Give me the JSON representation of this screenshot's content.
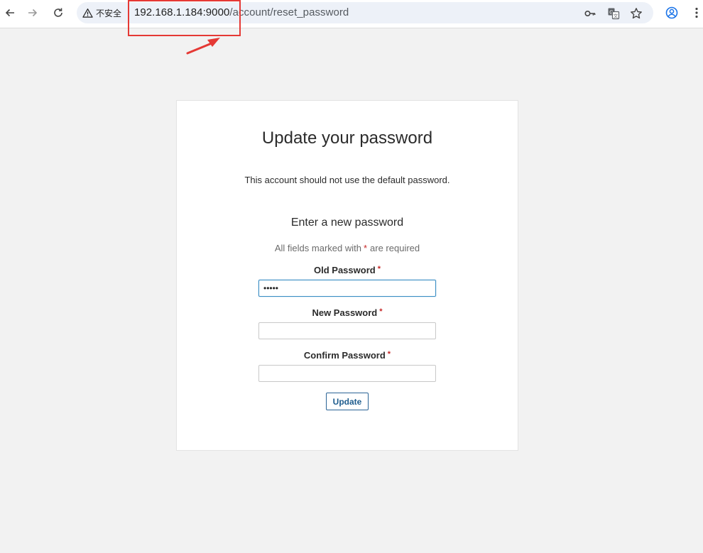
{
  "browser": {
    "security_label": "不安全",
    "url_host": "192.168.1.184:9000",
    "url_path": "/account/reset_password"
  },
  "page": {
    "title": "Update your password",
    "subtitle": "This account should not use the default password.",
    "section_title": "Enter a new password",
    "required_note_prefix": "All fields marked with",
    "required_star": "*",
    "required_note_suffix": "are required",
    "fields": [
      {
        "label": "Old Password",
        "value": "•••••",
        "placeholder": ""
      },
      {
        "label": "New Password",
        "value": "",
        "placeholder": ""
      },
      {
        "label": "Confirm Password",
        "value": "",
        "placeholder": ""
      }
    ],
    "update_label": "Update"
  },
  "colors": {
    "annotation": "#e53935",
    "required": "#c62828",
    "button_border": "#2a6496",
    "focus_border": "#3c8fc5"
  },
  "icons": {
    "back": "arrow-left-icon",
    "forward": "arrow-right-icon",
    "reload": "reload-icon",
    "warning": "warning-triangle-icon",
    "password": "key-icon",
    "translate": "translate-icon",
    "bookmark": "star-icon",
    "profile": "profile-icon",
    "menu": "kebab-menu-icon"
  }
}
